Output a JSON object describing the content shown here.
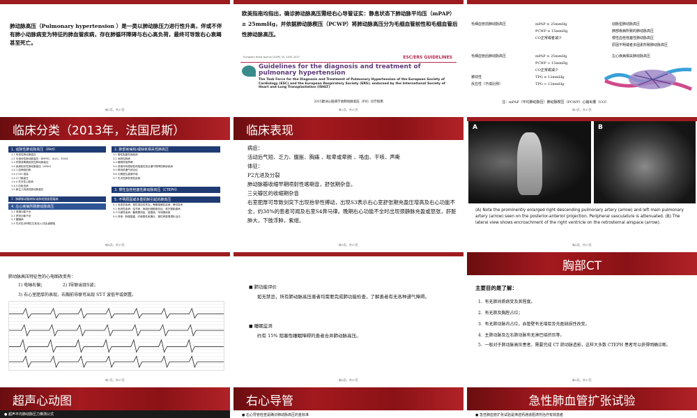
{
  "slides": {
    "s1": {
      "text": "肺动脉高压（Pulmonary hypertension ）是一类以肺动脉压力进行性升高，伴或不伴有肺小动脉病变为特征的肺血管疾病，存在肺循环障碍与右心高负荷，最终可导致右心衰竭甚至死亡。",
      "footer": "新1页，共37页"
    },
    "s2": {
      "text": "欧美指南均指出，确诊肺动脉高压需经右心导管证实：静息状态下肺动脉平均压（mPAP）≥ 25mmHg，并依据肺动脉楔压（PCWP）将肺动脉高压分为毛细血管前性和毛细血管后性肺动脉高压。",
      "esc_banner": "ESC/ERS GUIDELINES",
      "journal_line": "European Heart Journal (2009) 30, 2493–2537",
      "guideline_title": "Guidelines for the diagnosis and treatment of pulmonary hypertension",
      "guideline_sub": "The Task Force for the Diagnosis and Treatment of Pulmonary Hypertension of the European Society of Cardiology (ESC) and the European Respiratory Society (ERS), endorsed by the International Society of Heart and Lung Transplantation (ISHLT)",
      "caption": "2015欧洲心脏病学会肺动脉高压（PH）诊疗指南",
      "footer": "新2页，共37页"
    },
    "s3": {
      "row1": [
        "毛细血管前肺动脉高压",
        "mPAP ≥ 25mmHg",
        "动脉型肺动脉高压"
      ],
      "row1b": [
        "",
        "PCWP ≤ 15mmHg",
        "肺部疾病所致的肺动脉高压"
      ],
      "row1c": [
        "",
        "CO正常或者减少",
        "慢性血栓栓塞性肺动脉高压"
      ],
      "row1d": [
        "",
        "",
        "原因不明或者多因素所致肺动脉高压"
      ],
      "row2": [
        "毛细血管后肺动脉高压",
        "mPAP ≥ 25mmHg",
        "左心疾病相关肺动脉高压"
      ],
      "row2b": [
        "",
        "PCWP > 15mmHg",
        ""
      ],
      "row2c": [
        "",
        "CO正常或减少",
        ""
      ],
      "row2d": [
        "被动性",
        "TPG ≤ 12mmHg",
        ""
      ],
      "row2e": [
        "反应性（不成比例）",
        "TPG > 12mmHg",
        ""
      ],
      "note": "注：mPAP（平均肺动脉压）肺动脉楔压（PCWP）心输出量（CO）",
      "footer": "新3页，共37页"
    },
    "s4": {
      "title": "临床分类（2013年，法国尼斯）",
      "boxes": [
        "1. 动脉性肺动脉高压（PAH）",
        "2. 肺部疾病和/或缺氧相关性肺高压",
        "1'. 肺静脉闭塞病和/或肺毛细血管瘤病",
        "3. 慢性血栓栓塞性肺动脉高压（CTEPH）",
        "4. 左心疾病所致肺动脉高压",
        "5. 不明原因或多重机制引起的肺高压"
      ],
      "list_left": [
        "1.1 特发性肺动脉高压",
        "1.2 可遗传性肺动脉高压：BMPR2，ALK1，ECN3",
        "1.3 药物或毒素相关性肺动脉高压",
        "1.4 疾病相关性肺动脉高压（APAH）",
        "1.4.1 结缔组织病",
        "1.4.2 HIV 感染",
        "1.4.3 门脉高压",
        "1.4.4 先天性心脏病",
        "1.4.5 血吸虫病",
        "1.5 新生儿持续性肺动脉高压"
      ],
      "list_left2": [
        "2.1 收缩功能不全",
        "2.2 舒张功能不全",
        "2.3 瓣膜病",
        "2.4 先天性/获得性左室流入/流出道梗阻"
      ],
      "list_right": [
        "3.1 慢性阻塞性肺疾病",
        "3.2 间质性肺病",
        "3.3 睡眠呼吸障碍",
        "3.4 其他伴有限制性和阻塞性混合通气障碍的肺部疾病",
        "3.5 肺泡低通气综合征",
        "3.6 长期居住高原环境",
        "3.7 先天性肺发育性疾病"
      ],
      "list_right2": [
        "5.1 血液学疾病：慢性溶血性贫血，骨髓增殖性疾病，脾切除术",
        "5.2 系统性疾病：结节病，肺组织细胞增多症，淋巴管肌瘤病",
        "5.3 代谢性疾病：糖原累积症，高雪病，甲状腺疾病",
        "5.4 其他：肿瘤阻塞，纤维素性纵隔炎，慢性肾衰竭透析治疗，"
      ],
      "footer": "新4页，共37页"
    },
    "s5": {
      "title": "临床表现",
      "lines": [
        "病症：",
        "活动后气短、乏力、腹胀、胸痛 、眩晕或晕厥 、咯血、干咳、声嘶",
        "体征：",
        "P2亢进及分裂",
        "肺动脉瓣收缩早期喷射性喀喇音，舒张期杂音。",
        "三尖瓣区的收缩期杂音",
        "右室肥厚可导致剑突下出现抬举性搏动，出现S3表示右心室舒张期充盈压增高及右心功能不全，约38%的患者可闻及右室S4奔马律。晚期右心功能不全时出现颈静脉充盈或怒张，肝脏肿大，下肢浮肿，紫绀。"
      ],
      "footer": "新5页，共37页"
    },
    "s6": {
      "label_a": "A",
      "label_b": "B",
      "caption": "(A) Note the prominently enlarged right descending pulmonary  artery (arrow) and left main pulmonary artery (arrow) seen on the posterior-anterior projection. Peripheral vasculature is attenuated. (B) The lateral view shows encroachment of the right ventricle on the retrosternal airspace (arrow).",
      "footer": "新6页，共37页"
    },
    "s7": {
      "intro": "肺动脉高压特征性的心电图改变有：",
      "items": [
        "1) 电轴右偏；",
        "2) Ⅰ导联出现S波；",
        "3) 右心室肥厚的表现，右胸前导联可出现 ST-T 波低平或倒置。"
      ],
      "footer": "新7页，共37页"
    },
    "s8": {
      "h1": "肺功能评价",
      "p1": "如无禁忌，所有肺动脉高压患者均需要完成肺功能检查，了解患者有无各种通气障碍。",
      "h2": "睡眠监测",
      "p2": "约有 15% 阻塞性睡眠障碍的患者合并肺动脉高压。",
      "footer": "新8页，共37页"
    },
    "s9": {
      "title": "胸部CT",
      "lead": "主要目的是了解：",
      "items": [
        "有无肺间质病变及其程度。",
        "有无肺及胸腔占位；",
        "有无肺动脉内占位，血管壁有无增厚及充盈缺损性改变。",
        "主肺动脉及左右肺动脉有无淋巴结挤压等。",
        "一般对于肺动脉高压患者，需要完成 CT 肺动脉造影，这样大多数 CTEPH 患者可以获得明确诊断。"
      ],
      "footer": "新9页，共37页"
    },
    "s10": {
      "title": "超声心动图",
      "line": "● 超声平均肺动脉压力推测公式"
    },
    "s11": {
      "title": "右心导管",
      "line": "● 右心导管检查是确诊肺动脉高压的金标准"
    },
    "s12": {
      "title": "急性肺血管扩张试验",
      "line": "● 急性肺血管扩张试验是筛选钙通道阻滞剂治疗有效患者"
    }
  }
}
